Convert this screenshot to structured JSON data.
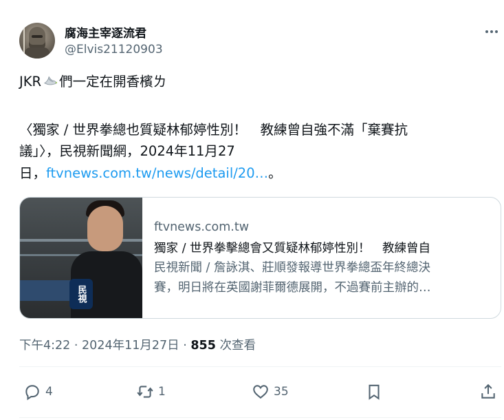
{
  "author": {
    "display_name": "腐海主宰逐流君",
    "handle": "@Elvis21120903"
  },
  "tweet": {
    "line1_prefix": "JKR",
    "line1_suffix": "們一定在開香檳ㄌ",
    "line2": "〈獨家 / 世界拳總也質疑林郁婷性別！　教練曾自強不滿「棄賽抗",
    "line3": "議」〉，民視新聞網，2024年11月27",
    "line4_prefix": "日，",
    "line4_link": "ftvnews.com.tw/news/detail/20…",
    "line4_suffix": "。"
  },
  "card": {
    "image_caption": "民視",
    "domain": "ftvnews.com.tw",
    "title": "獨家 / 世界拳擊總會又質疑林郁婷性別！　教練曾自",
    "desc_line1": "民視新聞 / 詹詠淇、莊順發報導世界拳總盃年終總決",
    "desc_line2": "賽，明日將在英國謝菲爾德展開，不過賽前主辦的…"
  },
  "meta": {
    "time": "下午4:22",
    "sep": "·",
    "date": "2024年11月27日",
    "views": "855",
    "views_label": "次查看"
  },
  "actions": {
    "reply_count": "4",
    "retweet_count": "1",
    "like_count": "35"
  },
  "colors": {
    "link": "#1d9bf0",
    "secondary_text": "#536471",
    "border": "#cfd9de"
  },
  "icons": [
    "more-icon",
    "dove-emoji",
    "reply-icon",
    "retweet-icon",
    "like-icon",
    "bookmark-icon",
    "share-icon"
  ]
}
